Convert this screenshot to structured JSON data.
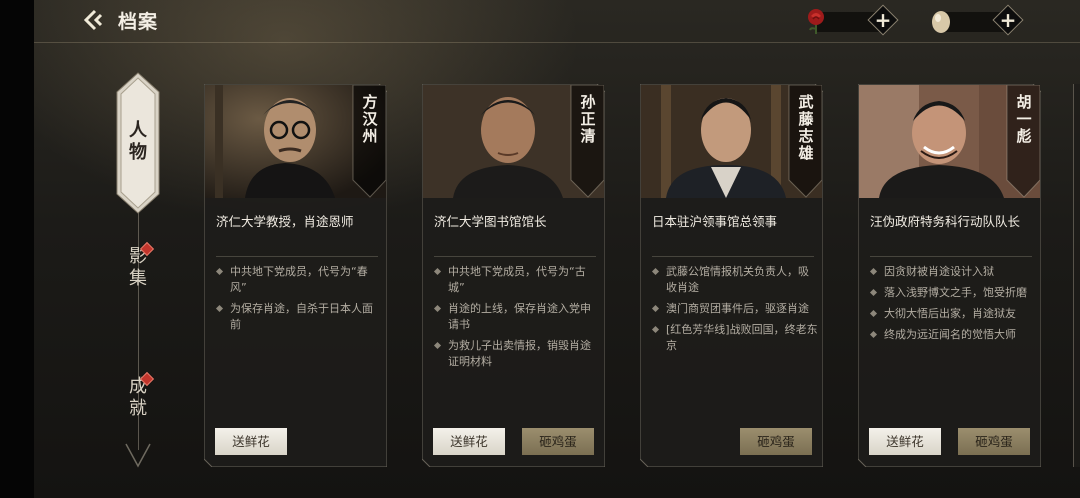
{
  "header": {
    "title": "档案"
  },
  "resources": [
    {
      "icon": "rose-icon",
      "value": "0"
    },
    {
      "icon": "egg-icon",
      "value": "0"
    }
  ],
  "sidenav": {
    "tabs": [
      {
        "label": "人物",
        "active": true,
        "badge": false
      },
      {
        "label": "影集",
        "active": false,
        "badge": true
      },
      {
        "label": "成就",
        "active": false,
        "badge": true
      }
    ]
  },
  "cards": [
    {
      "name": "方汉州",
      "role": "济仁大学教授，肖途恩师",
      "bullets": [
        "中共地下党成员，代号为“春风”",
        "为保存肖途，自杀于日本人面前"
      ],
      "flower_label": "送鲜花",
      "egg_label": "",
      "show_egg": false
    },
    {
      "name": "孙正清",
      "role": "济仁大学图书馆馆长",
      "bullets": [
        "中共地下党成员，代号为“古城”",
        "肖途的上线，保存肖途入党申请书",
        "为救儿子出卖情报，销毁肖途证明材料"
      ],
      "flower_label": "送鲜花",
      "egg_label": "砸鸡蛋",
      "show_egg": true
    },
    {
      "name": "武藤志雄",
      "role": "日本驻沪领事馆总领事",
      "bullets": [
        "武藤公馆情报机关负责人，吸收肖途",
        "澳门商贸团事件后，驱逐肖途",
        "[红色芳华线]战败回国，终老东京"
      ],
      "flower_label": "",
      "egg_label": "砸鸡蛋",
      "show_egg": true
    },
    {
      "name": "胡一彪",
      "role": "汪伪政府特务科行动队队长",
      "bullets": [
        "因贪财被肖途设计入狱",
        "落入浅野博文之手，饱受折磨",
        "大彻大悟后出家，肖途狱友",
        "终成为远近闻名的觉悟大师"
      ],
      "flower_label": "送鲜花",
      "egg_label": "砸鸡蛋",
      "show_egg": true
    }
  ]
}
